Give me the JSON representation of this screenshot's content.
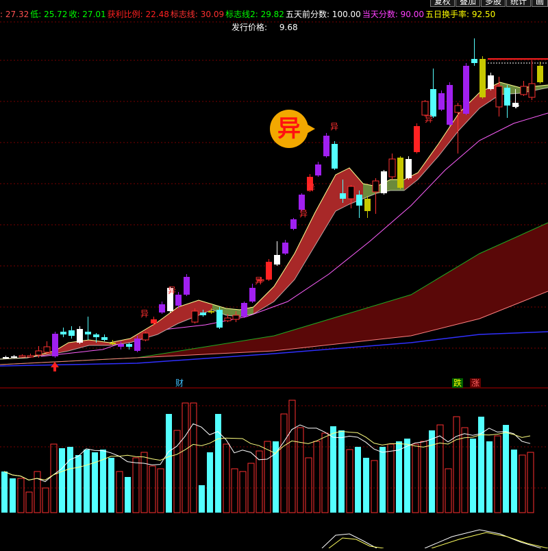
{
  "info_bar": {
    "high": {
      "label": "",
      "value": ": 27.32",
      "color": "#ffffff"
    },
    "low": {
      "label": "低",
      "value": ": 25.72",
      "color": "#ffffff"
    },
    "close": {
      "label": "收",
      "value": ": 27.01",
      "color": "#ffffff"
    },
    "fields": [
      {
        "text": "27.32",
        "prefix": ": ",
        "color": "#ff5050"
      },
      {
        "text": "低: 25.72",
        "color": "#00ff00"
      },
      {
        "text": "收: 27.01",
        "color": "#00ff00"
      },
      {
        "text": "获利比例: 22.48",
        "color": "#ff2020"
      },
      {
        "text": "标志线: 30.09",
        "color": "#ff3030"
      },
      {
        "text": "标志线2: 29.82",
        "color": "#00ff00"
      },
      {
        "text": "五天前分数: 100.00",
        "color": "#ffffff"
      },
      {
        "text": "当天分数: 90.00",
        "color": "#ff40ff"
      },
      {
        "text": "五日换手率: 92.50",
        "color": "#ffff00"
      }
    ]
  },
  "issue_price": {
    "label": "发行价格:",
    "value": "9.68"
  },
  "toolbar": {
    "buttons": [
      "复权",
      "叠加",
      "多股",
      "统计",
      "画"
    ]
  },
  "badges": {
    "yi_bubble": "异",
    "yi_label": "异",
    "cai": "财",
    "die": "跌",
    "zhang": "涨"
  },
  "colors": {
    "up_red": "#ff2222",
    "up_hollow": "#ff3030",
    "down_cyan": "#54ffff",
    "purple": "#a020f0",
    "olive": "#c8c800",
    "band_red": "#a82828",
    "band_green": "#6b8a3c",
    "grid": "#7a0000",
    "ma_blue": "#3030ff",
    "ma_green": "#22aa22",
    "ma_pink": "#ff60ff",
    "vol_ma_yellow": "#ffff80",
    "vol_ma_white": "#ffffff"
  },
  "chart_data": {
    "type": "candlestick",
    "candles": [
      {
        "o": 522,
        "c": 521,
        "h": 519,
        "l": 524,
        "color": "white"
      },
      {
        "o": 521,
        "c": 520,
        "h": 518,
        "l": 523,
        "color": "white"
      },
      {
        "o": 521,
        "c": 519,
        "h": 517,
        "l": 522,
        "color": "red_hollow"
      },
      {
        "o": 520,
        "c": 519,
        "h": 516,
        "l": 522,
        "color": "red_hollow"
      },
      {
        "o": 518,
        "c": 512,
        "h": 505,
        "l": 522,
        "color": "red_hollow"
      },
      {
        "o": 514,
        "c": 506,
        "h": 498,
        "l": 516,
        "color": "red_hollow"
      },
      {
        "o": 520,
        "c": 487,
        "h": 484,
        "l": 522,
        "color": "purple"
      },
      {
        "o": 488,
        "c": 484,
        "h": 478,
        "l": 492,
        "color": "cyan"
      },
      {
        "o": 490,
        "c": 482,
        "h": 476,
        "l": 494,
        "color": "cyan"
      },
      {
        "o": 500,
        "c": 480,
        "h": 476,
        "l": 502,
        "color": "white"
      },
      {
        "o": 484,
        "c": 488,
        "h": 462,
        "l": 496,
        "color": "cyan"
      },
      {
        "o": 488,
        "c": 492,
        "h": 486,
        "l": 500,
        "color": "cyan"
      },
      {
        "o": 492,
        "c": 496,
        "h": 488,
        "l": 498,
        "color": "cyan"
      },
      {
        "o": 500,
        "c": 502,
        "h": 496,
        "l": 504,
        "color": "olive"
      },
      {
        "o": 502,
        "c": 506,
        "h": 498,
        "l": 510,
        "color": "purple"
      },
      {
        "o": 506,
        "c": 502,
        "h": 500,
        "l": 510,
        "color": "cyan"
      },
      {
        "o": 512,
        "c": 494,
        "h": 490,
        "l": 514,
        "color": "purple"
      },
      {
        "o": 496,
        "c": 486,
        "h": 484,
        "l": 498,
        "color": "red_hollow"
      },
      {
        "o": 472,
        "c": 466,
        "h": 462,
        "l": 476,
        "color": "red"
      },
      {
        "o": 456,
        "c": 444,
        "h": 440,
        "l": 458,
        "color": "purple"
      },
      {
        "o": 420,
        "c": 454,
        "h": 418,
        "l": 456,
        "color": "white"
      },
      {
        "o": 446,
        "c": 430,
        "h": 426,
        "l": 450,
        "color": "purple"
      },
      {
        "o": 430,
        "c": 404,
        "h": 400,
        "l": 432,
        "color": "purple"
      },
      {
        "o": 470,
        "c": 454,
        "h": 450,
        "l": 472,
        "color": "red_hollow"
      },
      {
        "o": 456,
        "c": 460,
        "h": 452,
        "l": 462,
        "color": "cyan"
      },
      {
        "o": 454,
        "c": 456,
        "h": 450,
        "l": 458,
        "color": "olive"
      },
      {
        "o": 452,
        "c": 478,
        "h": 448,
        "l": 480,
        "color": "cyan"
      },
      {
        "o": 468,
        "c": 464,
        "h": 458,
        "l": 470,
        "color": "red_hollow"
      },
      {
        "o": 466,
        "c": 460,
        "h": 454,
        "l": 470,
        "color": "red_hollow"
      },
      {
        "o": 462,
        "c": 442,
        "h": 440,
        "l": 464,
        "color": "purple"
      },
      {
        "o": 440,
        "c": 420,
        "h": 414,
        "l": 442,
        "color": "purple"
      },
      {
        "o": 410,
        "c": 408,
        "h": 404,
        "l": 414,
        "color": "red_hollow"
      },
      {
        "o": 408,
        "c": 382,
        "h": 378,
        "l": 410,
        "color": "red"
      },
      {
        "o": 372,
        "c": 386,
        "h": 352,
        "l": 388,
        "color": "white"
      },
      {
        "o": 370,
        "c": 354,
        "h": 350,
        "l": 372,
        "color": "purple"
      },
      {
        "o": 334,
        "c": 320,
        "h": 318,
        "l": 336,
        "color": "purple"
      },
      {
        "o": 306,
        "c": 284,
        "h": 282,
        "l": 308,
        "color": "purple"
      },
      {
        "o": 278,
        "c": 258,
        "h": 254,
        "l": 280,
        "color": "red"
      },
      {
        "o": 256,
        "c": 240,
        "h": 236,
        "l": 258,
        "color": "purple"
      },
      {
        "o": 228,
        "c": 198,
        "h": 194,
        "l": 230,
        "color": "purple"
      },
      {
        "o": 210,
        "c": 246,
        "h": 206,
        "l": 248,
        "color": "cyan"
      },
      {
        "o": 282,
        "c": 290,
        "h": 262,
        "l": 296,
        "color": "cyan"
      },
      {
        "o": 290,
        "c": 272,
        "h": 270,
        "l": 304,
        "color": "red_hollow"
      },
      {
        "o": 284,
        "c": 300,
        "h": 278,
        "l": 318,
        "color": "cyan"
      },
      {
        "o": 290,
        "c": 308,
        "h": 286,
        "l": 318,
        "color": "olive"
      },
      {
        "o": 280,
        "c": 264,
        "h": 260,
        "l": 312,
        "color": "red_hollow"
      },
      {
        "o": 282,
        "c": 250,
        "h": 248,
        "l": 284,
        "color": "white"
      },
      {
        "o": 258,
        "c": 232,
        "h": 224,
        "l": 262,
        "color": "red_hollow"
      },
      {
        "o": 274,
        "c": 230,
        "h": 228,
        "l": 276,
        "color": "olive"
      },
      {
        "o": 260,
        "c": 232,
        "h": 228,
        "l": 262,
        "color": "white"
      },
      {
        "o": 222,
        "c": 184,
        "h": 180,
        "l": 224,
        "color": "red"
      },
      {
        "o": 168,
        "c": 148,
        "h": 146,
        "l": 170,
        "color": "red_hollow"
      },
      {
        "o": 170,
        "c": 130,
        "h": 100,
        "l": 172,
        "color": "cyan"
      },
      {
        "o": 160,
        "c": 136,
        "h": 132,
        "l": 162,
        "color": "purple"
      },
      {
        "o": 182,
        "c": 124,
        "h": 120,
        "l": 184,
        "color": "purple"
      },
      {
        "o": 164,
        "c": 154,
        "h": 150,
        "l": 224,
        "color": "red_hollow"
      },
      {
        "o": 166,
        "c": 96,
        "h": 92,
        "l": 168,
        "color": "purple"
      },
      {
        "o": 92,
        "c": 86,
        "h": 56,
        "l": 96,
        "color": "cyan"
      },
      {
        "o": 142,
        "c": 86,
        "h": 82,
        "l": 144,
        "color": "olive"
      },
      {
        "o": 110,
        "c": 130,
        "h": 106,
        "l": 132,
        "color": "white"
      },
      {
        "o": 126,
        "c": 156,
        "h": 112,
        "l": 170,
        "color": "red_hollow"
      },
      {
        "o": 128,
        "c": 154,
        "h": 124,
        "l": 172,
        "color": "cyan"
      },
      {
        "o": 156,
        "c": 150,
        "h": 130,
        "l": 158,
        "color": "white"
      },
      {
        "o": 138,
        "c": 126,
        "h": 118,
        "l": 140,
        "color": "red_hollow"
      },
      {
        "o": 142,
        "c": 122,
        "h": 88,
        "l": 146,
        "color": "red_hollow"
      },
      {
        "o": 120,
        "c": 96,
        "h": 90,
        "l": 122,
        "color": "olive"
      }
    ],
    "volume": [
      30,
      25,
      25,
      15,
      30,
      18,
      50,
      47,
      48,
      42,
      46,
      44,
      46,
      40,
      30,
      26,
      40,
      44,
      34,
      32,
      72,
      60,
      80,
      80,
      20,
      44,
      72,
      50,
      32,
      30,
      36,
      45,
      52,
      52,
      72,
      82,
      62,
      40,
      52,
      58,
      63,
      60,
      46,
      48,
      40,
      38,
      48,
      50,
      52,
      54,
      50,
      52,
      60,
      64,
      32,
      70,
      62,
      54,
      70,
      52,
      56,
      64,
      46,
      42,
      44
    ]
  }
}
